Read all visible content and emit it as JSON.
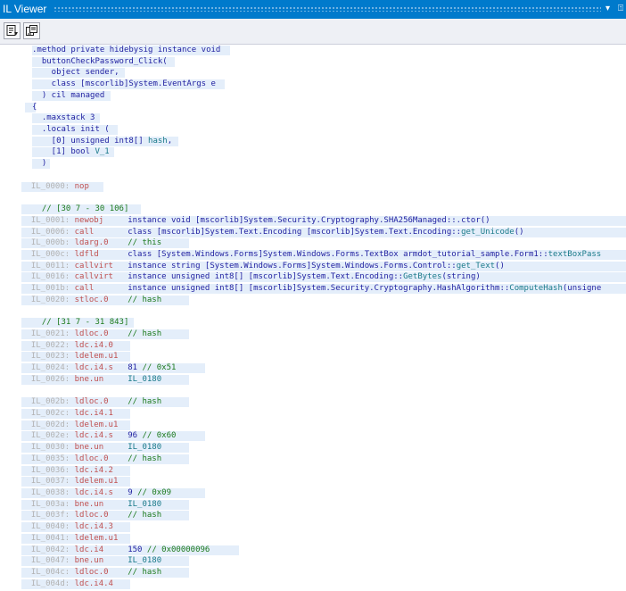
{
  "window": {
    "title": "IL Viewer",
    "pin_glyph": "▾",
    "close_glyph": "⍐"
  },
  "toolbar": {
    "buttons": [
      {
        "name": "view-options-button",
        "icon": "switch-view-icon"
      },
      {
        "name": "sync-button",
        "icon": "sync-icon"
      }
    ]
  },
  "code_lines": [
    {
      "hl": [
        36,
        258
      ],
      "segs": [
        [
          "kw",
          ".method private hidebysig instance void"
        ]
      ]
    },
    {
      "hl": [
        36,
        196
      ],
      "segs": [
        [
          "kw",
          "  buttonCheckPassword_Click("
        ]
      ]
    },
    {
      "hl": [
        36,
        140
      ],
      "segs": [
        [
          "kw",
          "    object sender,"
        ]
      ]
    },
    {
      "hl": [
        36,
        252
      ],
      "segs": [
        [
          "kw",
          "    class [mscorlib]System.EventArgs e"
        ]
      ]
    },
    {
      "hl": [
        36,
        124
      ],
      "segs": [
        [
          "kw",
          "  ) cil managed"
        ]
      ]
    },
    {
      "hl": [
        28,
        40
      ],
      "segs": [
        [
          "kw",
          "{"
        ]
      ]
    },
    {
      "hl": [
        36,
        112
      ],
      "segs": [
        [
          "kw",
          "  .maxstack 3"
        ]
      ]
    },
    {
      "hl": [
        36,
        132
      ],
      "segs": [
        [
          "kw",
          "  .locals init ("
        ]
      ]
    },
    {
      "hl": [
        36,
        200
      ],
      "segs": [
        [
          "kw",
          "    [0] unsigned int8[] "
        ],
        [
          "mem",
          "hash"
        ],
        [
          "kw",
          ","
        ]
      ]
    },
    {
      "hl": [
        36,
        128
      ],
      "segs": [
        [
          "kw",
          "    [1] bool "
        ],
        [
          "mem",
          "V_1"
        ]
      ]
    },
    {
      "hl": [
        36,
        56
      ],
      "segs": [
        [
          "kw",
          "  )"
        ]
      ]
    },
    {
      "hl": null,
      "segs": []
    },
    {
      "hl": [
        24,
        116
      ],
      "segs": [
        [
          "lbl",
          "  IL_0000: "
        ],
        [
          "op",
          "nop"
        ]
      ]
    },
    {
      "hl": null,
      "segs": []
    },
    {
      "hl": [
        24,
        158
      ],
      "segs": [
        [
          "cm",
          "  // [30 7 - 30 106]"
        ]
      ]
    },
    {
      "hl": [
        24,
        702
      ],
      "segs": [
        [
          "lbl",
          "  IL_0001: "
        ],
        [
          "op",
          "newobj     "
        ],
        [
          "kw",
          "instance void [mscorlib]System.Security.Cryptography.SHA256Managed::.ctor()"
        ]
      ]
    },
    {
      "hl": [
        24,
        702
      ],
      "segs": [
        [
          "lbl",
          "  IL_0006: "
        ],
        [
          "op",
          "call       "
        ],
        [
          "kw",
          "class [mscorlib]System.Text.Encoding [mscorlib]System.Text.Encoding::"
        ],
        [
          "mem",
          "get_Unicode"
        ],
        [
          "kw",
          "()"
        ]
      ]
    },
    {
      "hl": [
        24,
        212
      ],
      "segs": [
        [
          "lbl",
          "  IL_000b: "
        ],
        [
          "op",
          "ldarg.0    "
        ],
        [
          "cm",
          "// this"
        ]
      ]
    },
    {
      "hl": [
        24,
        702
      ],
      "segs": [
        [
          "lbl",
          "  IL_000c: "
        ],
        [
          "op",
          "ldfld      "
        ],
        [
          "kw",
          "class [System.Windows.Forms]System.Windows.Forms.TextBox armdot_tutorial_sample.Form1::"
        ],
        [
          "mem",
          "textBoxPass"
        ]
      ]
    },
    {
      "hl": [
        24,
        702
      ],
      "segs": [
        [
          "lbl",
          "  IL_0011: "
        ],
        [
          "op",
          "callvirt   "
        ],
        [
          "kw",
          "instance string [System.Windows.Forms]System.Windows.Forms.Control::"
        ],
        [
          "mem",
          "get_Text"
        ],
        [
          "kw",
          "()"
        ]
      ]
    },
    {
      "hl": [
        24,
        702
      ],
      "segs": [
        [
          "lbl",
          "  IL_0016: "
        ],
        [
          "op",
          "callvirt   "
        ],
        [
          "kw",
          "instance unsigned int8[] [mscorlib]System.Text.Encoding::"
        ],
        [
          "mem",
          "GetBytes"
        ],
        [
          "kw",
          "(string)"
        ]
      ]
    },
    {
      "hl": [
        24,
        702
      ],
      "segs": [
        [
          "lbl",
          "  IL_001b: "
        ],
        [
          "op",
          "call       "
        ],
        [
          "kw",
          "instance unsigned int8[] [mscorlib]System.Security.Cryptography.HashAlgorithm::"
        ],
        [
          "mem",
          "ComputeHash"
        ],
        [
          "kw",
          "(unsigne"
        ]
      ]
    },
    {
      "hl": [
        24,
        212
      ],
      "segs": [
        [
          "lbl",
          "  IL_0020: "
        ],
        [
          "op",
          "stloc.0    "
        ],
        [
          "cm",
          "// hash"
        ]
      ]
    },
    {
      "hl": null,
      "segs": []
    },
    {
      "hl": [
        24,
        150
      ],
      "segs": [
        [
          "cm",
          "  // [31 7 - 31 843]"
        ]
      ]
    },
    {
      "hl": [
        24,
        212
      ],
      "segs": [
        [
          "lbl",
          "  IL_0021: "
        ],
        [
          "op",
          "ldloc.0    "
        ],
        [
          "cm",
          "// hash"
        ]
      ]
    },
    {
      "hl": [
        24,
        146
      ],
      "segs": [
        [
          "lbl",
          "  IL_0022: "
        ],
        [
          "op",
          "ldc.i4.0"
        ]
      ]
    },
    {
      "hl": [
        24,
        146
      ],
      "segs": [
        [
          "lbl",
          "  IL_0023: "
        ],
        [
          "op",
          "ldelem.u1"
        ]
      ]
    },
    {
      "hl": [
        24,
        230
      ],
      "segs": [
        [
          "lbl",
          "  IL_0024: "
        ],
        [
          "op",
          "ldc.i4.s   "
        ],
        [
          "num",
          "81 "
        ],
        [
          "cm",
          "// 0x51"
        ]
      ]
    },
    {
      "hl": [
        24,
        212
      ],
      "segs": [
        [
          "lbl",
          "  IL_0026: "
        ],
        [
          "op",
          "bne.un     "
        ],
        [
          "tgt",
          "IL_0180"
        ]
      ]
    },
    {
      "hl": null,
      "segs": []
    },
    {
      "hl": [
        24,
        212
      ],
      "segs": [
        [
          "lbl",
          "  IL_002b: "
        ],
        [
          "op",
          "ldloc.0    "
        ],
        [
          "cm",
          "// hash"
        ]
      ]
    },
    {
      "hl": [
        24,
        146
      ],
      "segs": [
        [
          "lbl",
          "  IL_002c: "
        ],
        [
          "op",
          "ldc.i4.1"
        ]
      ]
    },
    {
      "hl": [
        24,
        146
      ],
      "segs": [
        [
          "lbl",
          "  IL_002d: "
        ],
        [
          "op",
          "ldelem.u1"
        ]
      ]
    },
    {
      "hl": [
        24,
        230
      ],
      "segs": [
        [
          "lbl",
          "  IL_002e: "
        ],
        [
          "op",
          "ldc.i4.s   "
        ],
        [
          "num",
          "96 "
        ],
        [
          "cm",
          "// 0x60"
        ]
      ]
    },
    {
      "hl": [
        24,
        212
      ],
      "segs": [
        [
          "lbl",
          "  IL_0030: "
        ],
        [
          "op",
          "bne.un     "
        ],
        [
          "tgt",
          "IL_0180"
        ]
      ]
    },
    {
      "hl": [
        24,
        212
      ],
      "segs": [
        [
          "lbl",
          "  IL_0035: "
        ],
        [
          "op",
          "ldloc.0    "
        ],
        [
          "cm",
          "// hash"
        ]
      ]
    },
    {
      "hl": [
        24,
        146
      ],
      "segs": [
        [
          "lbl",
          "  IL_0036: "
        ],
        [
          "op",
          "ldc.i4.2"
        ]
      ]
    },
    {
      "hl": [
        24,
        146
      ],
      "segs": [
        [
          "lbl",
          "  IL_0037: "
        ],
        [
          "op",
          "ldelem.u1"
        ]
      ]
    },
    {
      "hl": [
        24,
        230
      ],
      "segs": [
        [
          "lbl",
          "  IL_0038: "
        ],
        [
          "op",
          "ldc.i4.s   "
        ],
        [
          "num",
          "9 "
        ],
        [
          "cm",
          "// 0x09"
        ]
      ]
    },
    {
      "hl": [
        24,
        212
      ],
      "segs": [
        [
          "lbl",
          "  IL_003a: "
        ],
        [
          "op",
          "bne.un     "
        ],
        [
          "tgt",
          "IL_0180"
        ]
      ]
    },
    {
      "hl": [
        24,
        212
      ],
      "segs": [
        [
          "lbl",
          "  IL_003f: "
        ],
        [
          "op",
          "ldloc.0    "
        ],
        [
          "cm",
          "// hash"
        ]
      ]
    },
    {
      "hl": [
        24,
        146
      ],
      "segs": [
        [
          "lbl",
          "  IL_0040: "
        ],
        [
          "op",
          "ldc.i4.3"
        ]
      ]
    },
    {
      "hl": [
        24,
        146
      ],
      "segs": [
        [
          "lbl",
          "  IL_0041: "
        ],
        [
          "op",
          "ldelem.u1"
        ]
      ]
    },
    {
      "hl": [
        24,
        268
      ],
      "segs": [
        [
          "lbl",
          "  IL_0042: "
        ],
        [
          "op",
          "ldc.i4     "
        ],
        [
          "num",
          "150 "
        ],
        [
          "cm",
          "// 0x00000096"
        ]
      ]
    },
    {
      "hl": [
        24,
        212
      ],
      "segs": [
        [
          "lbl",
          "  IL_0047: "
        ],
        [
          "op",
          "bne.un     "
        ],
        [
          "tgt",
          "IL_0180"
        ]
      ]
    },
    {
      "hl": [
        24,
        212
      ],
      "segs": [
        [
          "lbl",
          "  IL_004c: "
        ],
        [
          "op",
          "ldloc.0    "
        ],
        [
          "cm",
          "// hash"
        ]
      ]
    },
    {
      "hl": [
        24,
        146
      ],
      "segs": [
        [
          "lbl",
          "  IL_004d: "
        ],
        [
          "op",
          "ldc.i4.4"
        ]
      ]
    }
  ]
}
